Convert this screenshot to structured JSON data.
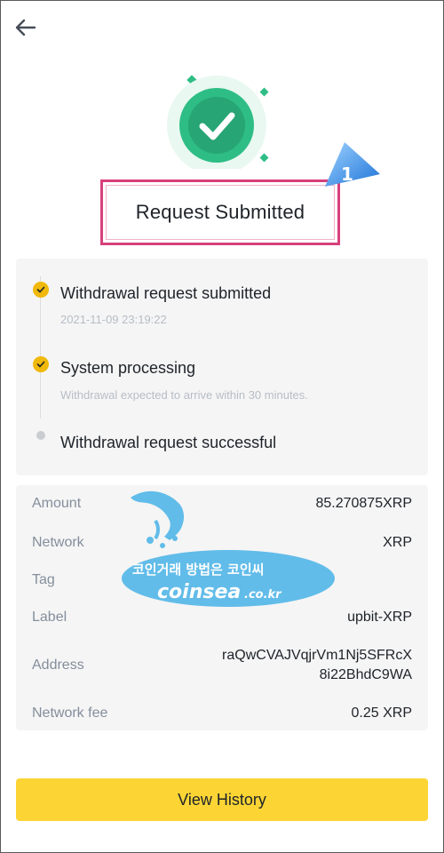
{
  "header": {
    "back_icon": "arrow-left-icon"
  },
  "status": {
    "icon": "check-circle-icon",
    "title": "Request Submitted",
    "accent": "#2ebd85",
    "annotation_number": "1"
  },
  "steps": [
    {
      "title": "Withdrawal request submitted",
      "subtitle": "2021-11-09 23:19:22",
      "state": "done"
    },
    {
      "title": "System processing",
      "subtitle": "Withdrawal expected to arrive within 30 minutes.",
      "state": "done"
    },
    {
      "title": "Withdrawal request successful",
      "subtitle": "",
      "state": "pending"
    }
  ],
  "details": {
    "amount": {
      "label": "Amount",
      "value": "85.270875XRP"
    },
    "network": {
      "label": "Network",
      "value": "XRP"
    },
    "tag": {
      "label": "Tag",
      "value": ""
    },
    "label": {
      "label": "Label",
      "value": "upbit-XRP"
    },
    "address": {
      "label": "Address",
      "value_line1": "raQwCVAJVqjrVm1Nj5SFRcX",
      "value_line2": "8i22BhdC9WA"
    },
    "fee": {
      "label": "Network fee",
      "value": "0.25 XRP"
    }
  },
  "watermark": {
    "line1": "코인거래 방법은 코인씨",
    "line2": "coinsea",
    "suffix": ".co.kr"
  },
  "actions": {
    "view_history": "View History",
    "button_color": "#fcd535"
  }
}
